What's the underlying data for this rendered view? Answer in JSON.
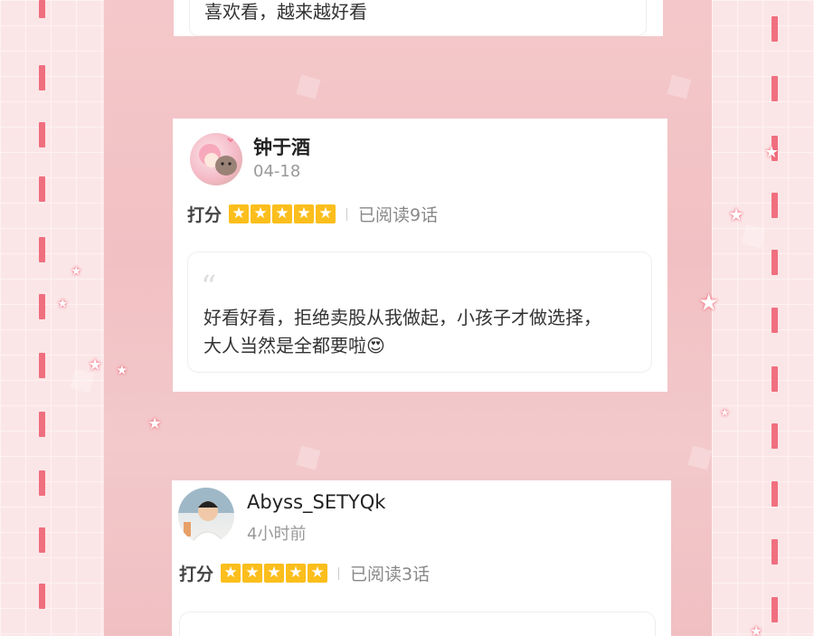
{
  "top_comment": {
    "text": "喜欢看，越来越好看"
  },
  "comments": [
    {
      "username": "钟于酒",
      "time": "04-18",
      "score_label": "打分",
      "rating": 5,
      "read_status": "已阅读9话",
      "text_line1": "好看好看，拒绝卖股从我做起，小孩子才做选择，",
      "text_line2": "大人当然是全都要啦😍"
    },
    {
      "username": "Abyss_SETYQk",
      "time": "4小时前",
      "score_label": "打分",
      "rating": 5,
      "read_status": "已阅读3话"
    }
  ],
  "colors": {
    "accent_star": "#fbbe1c",
    "dash": "#f06f7f",
    "background": "#f4c8ca"
  },
  "icons": {
    "star": "star-icon",
    "quote": "quote-icon"
  }
}
